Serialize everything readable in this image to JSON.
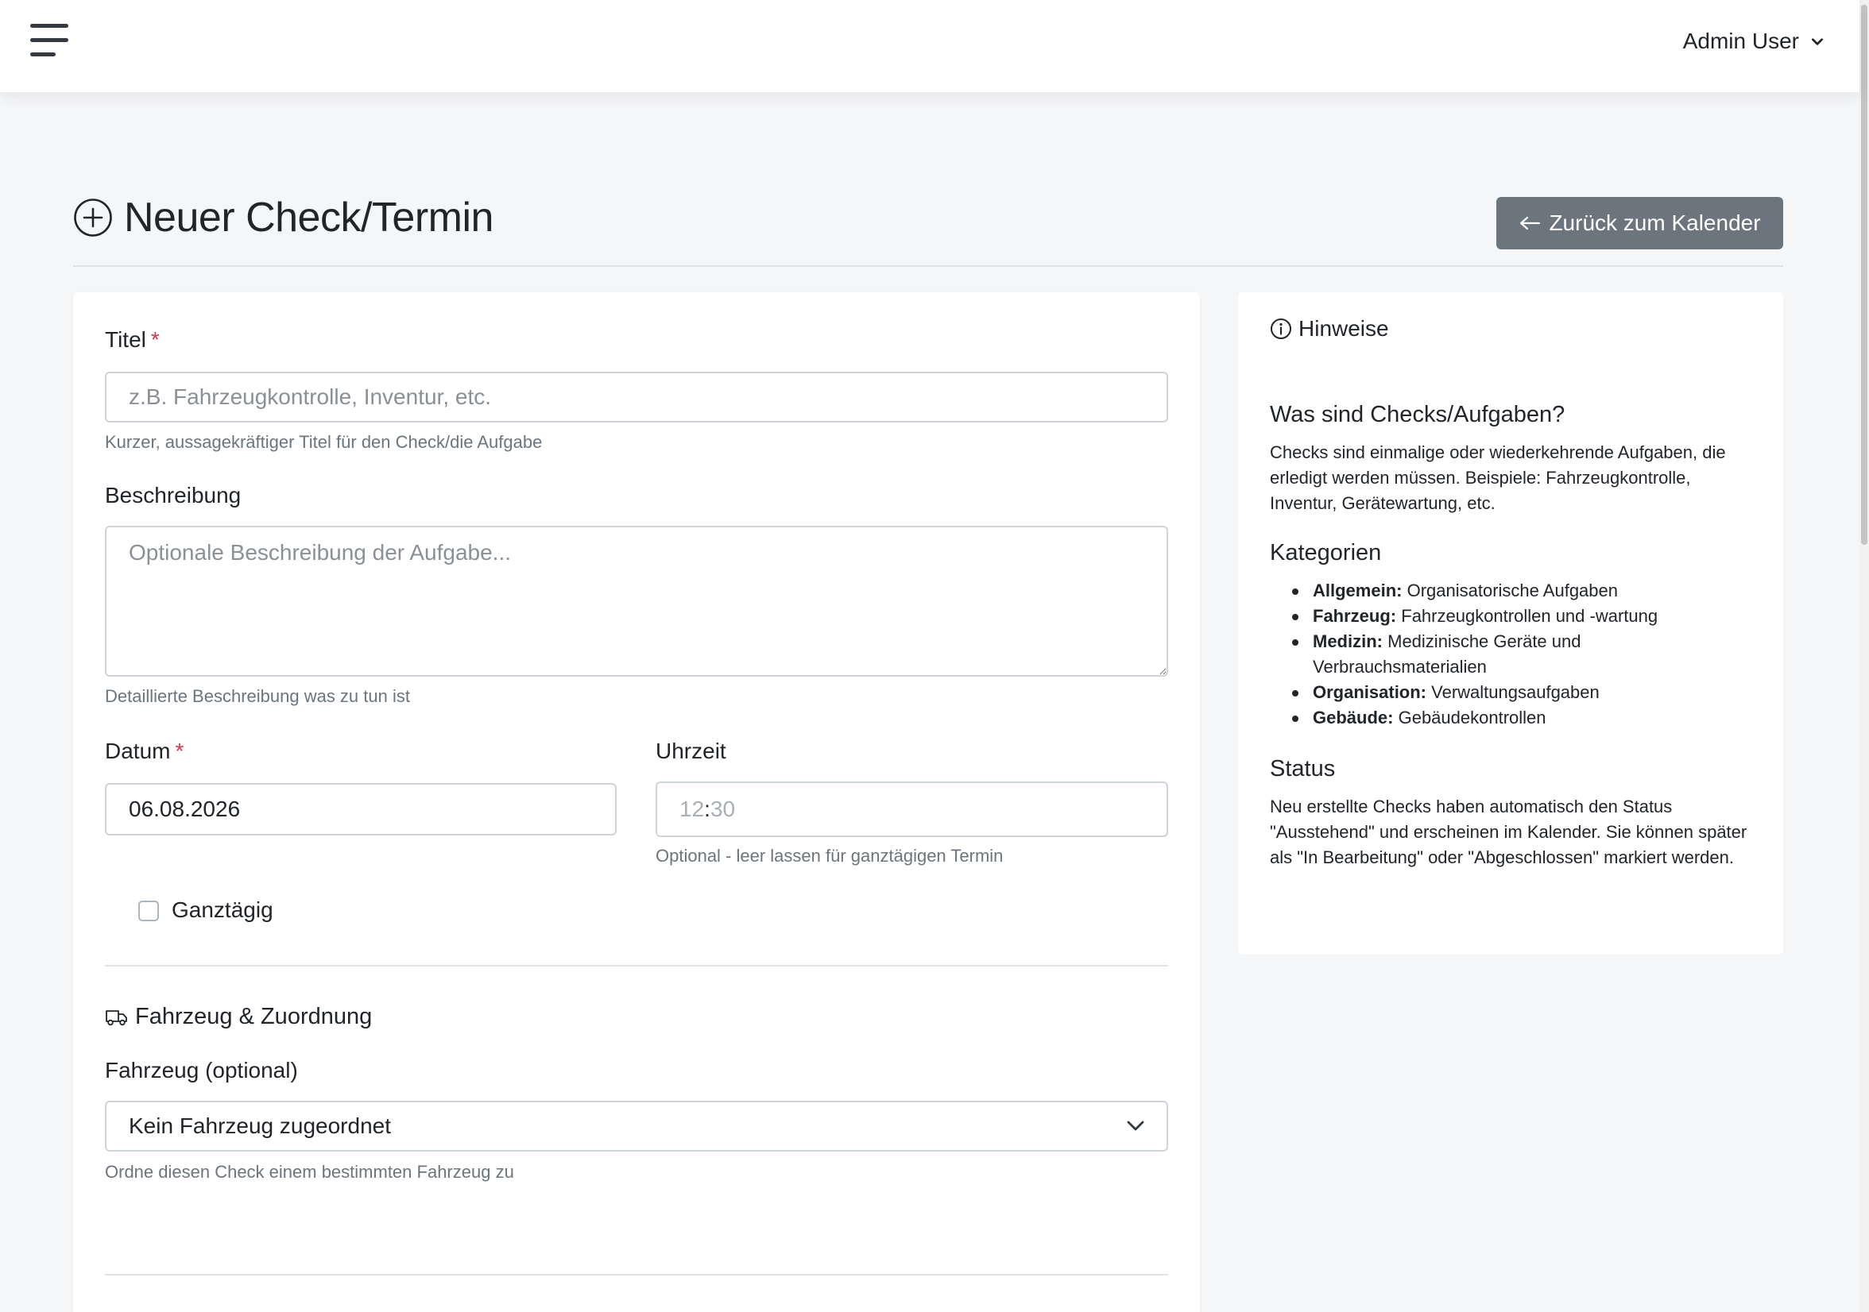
{
  "navbar": {
    "menu_icon": "hamburger-menu-icon",
    "user_name": "Admin User",
    "user_chevron_icon": "chevron-down-icon"
  },
  "page": {
    "title_icon": "plus-circle-icon",
    "title": "Neuer Check/Termin",
    "back_icon": "arrow-left-icon",
    "back_button": "Zurück zum Kalender"
  },
  "form": {
    "title": {
      "label": "Titel",
      "required_marker": "*",
      "value": "",
      "placeholder": "z.B. Fahrzeugkontrolle, Inventur, etc.",
      "help": "Kurzer, aussagekräftiger Titel für den Check/die Aufgabe"
    },
    "description": {
      "label": "Beschreibung",
      "value": "",
      "placeholder": "Optionale Beschreibung der Aufgabe...",
      "help": "Detaillierte Beschreibung was zu tun ist"
    },
    "date": {
      "label": "Datum",
      "required_marker": "*",
      "value": "06.08.2026"
    },
    "time": {
      "label": "Uhrzeit",
      "hour": "12",
      "separator": ":",
      "minute": "30",
      "help": "Optional - leer lassen für ganztägigen Termin"
    },
    "all_day": {
      "label": "Ganztägig",
      "checked": false
    },
    "vehicle_section": {
      "icon": "truck-icon",
      "title": "Fahrzeug & Zuordnung",
      "vehicle_label": "Fahrzeug (optional)",
      "vehicle_selected": "Kein Fahrzeug zugeordnet",
      "select_chevron_icon": "chevron-down-icon",
      "vehicle_help": "Ordne diesen Check einem bestimmten Fahrzeug zu"
    }
  },
  "sidebar": {
    "icon": "info-circle-icon",
    "title": "Hinweise",
    "what_heading": "Was sind Checks/Aufgaben?",
    "what_text": "Checks sind einmalige oder wiederkehrende Aufgaben, die erledigt werden müssen. Beispiele: Fahrzeugkontrolle, Inventur, Gerätewartung, etc.",
    "categories_heading": "Kategorien",
    "categories": [
      {
        "name": "Allgemein:",
        "desc": "Organisatorische Aufgaben"
      },
      {
        "name": "Fahrzeug:",
        "desc": "Fahrzeugkontrollen und -wartung"
      },
      {
        "name": "Medizin:",
        "desc": "Medizinische Geräte und Verbrauchsmaterialien"
      },
      {
        "name": "Organisation:",
        "desc": "Verwaltungsaufgaben"
      },
      {
        "name": "Gebäude:",
        "desc": "Gebäudekontrollen"
      }
    ],
    "status_heading": "Status",
    "status_text": "Neu erstellte Checks haben automatisch den Status \"Ausstehend\" und erscheinen im Kalender. Sie können später als \"In Bearbeitung\" oder \"Abgeschlossen\" markiert werden."
  },
  "colors": {
    "background": "#f5f6f8",
    "secondary_button": "#6c757d",
    "required": "#dc3545",
    "muted_text": "#6c757d"
  }
}
